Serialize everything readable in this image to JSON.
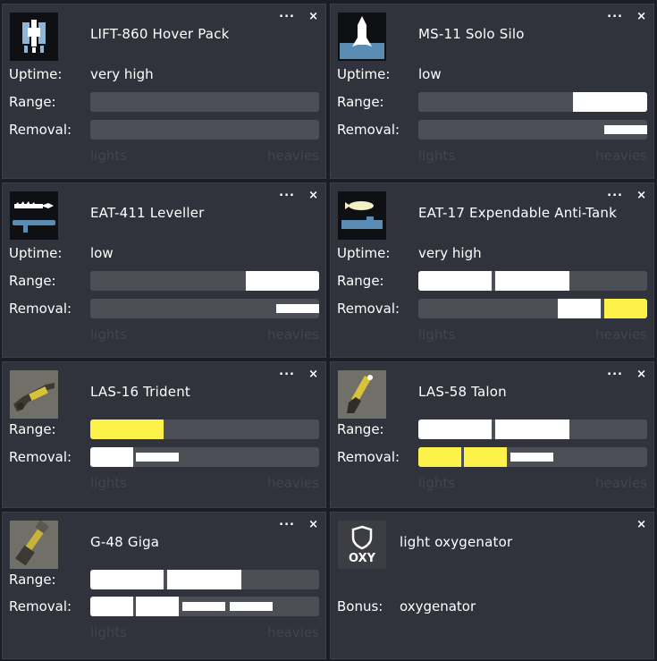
{
  "colors": {
    "white": "#ffffff",
    "yellow": "#fdf24a",
    "track": "#4c4f56"
  },
  "scale_labels": {
    "low": "lights",
    "high": "heavies"
  },
  "ctrl": {
    "more": "...",
    "close": "×"
  },
  "labels": {
    "uptime": "Uptime:",
    "range": "Range:",
    "removal": "Removal:",
    "bonus": "Bonus:"
  },
  "cards": [
    {
      "title": "LIFT-860 Hover Pack",
      "icon": "jetpack-icon",
      "uptime": "very high",
      "range": [],
      "removal": []
    },
    {
      "title": "MS-11 Solo Silo",
      "icon": "silo-missile-icon",
      "uptime": "low",
      "range": [
        {
          "from": 0.676,
          "to": 1.0,
          "color": "white",
          "style": "full"
        }
      ],
      "removal": [
        {
          "from": 0.814,
          "to": 1.0,
          "color": "white",
          "style": "slim"
        }
      ]
    },
    {
      "title": "EAT-411 Leveller",
      "icon": "launcher-icon",
      "uptime": "low",
      "range": [
        {
          "from": 0.678,
          "to": 1.0,
          "color": "white",
          "style": "full"
        }
      ],
      "removal": [
        {
          "from": 0.814,
          "to": 1.0,
          "color": "white",
          "style": "slim"
        }
      ]
    },
    {
      "title": "EAT-17 Expendable Anti-Tank",
      "icon": "rocket-icon",
      "uptime": "very high",
      "range": [
        {
          "from": 0.0,
          "to": 0.322,
          "color": "white",
          "style": "full"
        },
        {
          "from": 0.337,
          "to": 0.662,
          "color": "white",
          "style": "full"
        }
      ],
      "removal": [
        {
          "from": 0.61,
          "to": 0.798,
          "color": "white",
          "style": "full"
        },
        {
          "from": 0.814,
          "to": 1.0,
          "color": "yellow",
          "style": "full"
        }
      ]
    },
    {
      "title": "LAS-16 Trident",
      "icon": "laser-rifle-icon",
      "range": [
        {
          "from": 0.0,
          "to": 0.322,
          "color": "yellow",
          "style": "full"
        }
      ],
      "removal": [
        {
          "from": 0.0,
          "to": 0.186,
          "color": "white",
          "style": "full"
        },
        {
          "from": 0.2,
          "to": 0.388,
          "color": "white",
          "style": "slim"
        }
      ]
    },
    {
      "title": "LAS-58 Talon",
      "icon": "laser-pistol-icon",
      "range": [
        {
          "from": 0.0,
          "to": 0.322,
          "color": "white",
          "style": "full"
        },
        {
          "from": 0.337,
          "to": 0.662,
          "color": "white",
          "style": "full"
        }
      ],
      "removal": [
        {
          "from": 0.0,
          "to": 0.186,
          "color": "yellow",
          "style": "full"
        },
        {
          "from": 0.2,
          "to": 0.388,
          "color": "yellow",
          "style": "full"
        },
        {
          "from": 0.403,
          "to": 0.59,
          "color": "white",
          "style": "slim"
        }
      ]
    },
    {
      "title": "G-48 Giga",
      "icon": "grenade-icon",
      "range": [
        {
          "from": 0.0,
          "to": 0.322,
          "color": "white",
          "style": "full"
        },
        {
          "from": 0.337,
          "to": 0.662,
          "color": "white",
          "style": "full"
        }
      ],
      "removal": [
        {
          "from": 0.0,
          "to": 0.186,
          "color": "white",
          "style": "full"
        },
        {
          "from": 0.2,
          "to": 0.388,
          "color": "white",
          "style": "full"
        },
        {
          "from": 0.403,
          "to": 0.59,
          "color": "white",
          "style": "slim"
        },
        {
          "from": 0.61,
          "to": 0.798,
          "color": "white",
          "style": "slim"
        }
      ]
    },
    {
      "title": "light oxygenator",
      "icon": "shield-oxy-icon",
      "icon_text": "OXY",
      "bonus": "oxygenator"
    }
  ]
}
